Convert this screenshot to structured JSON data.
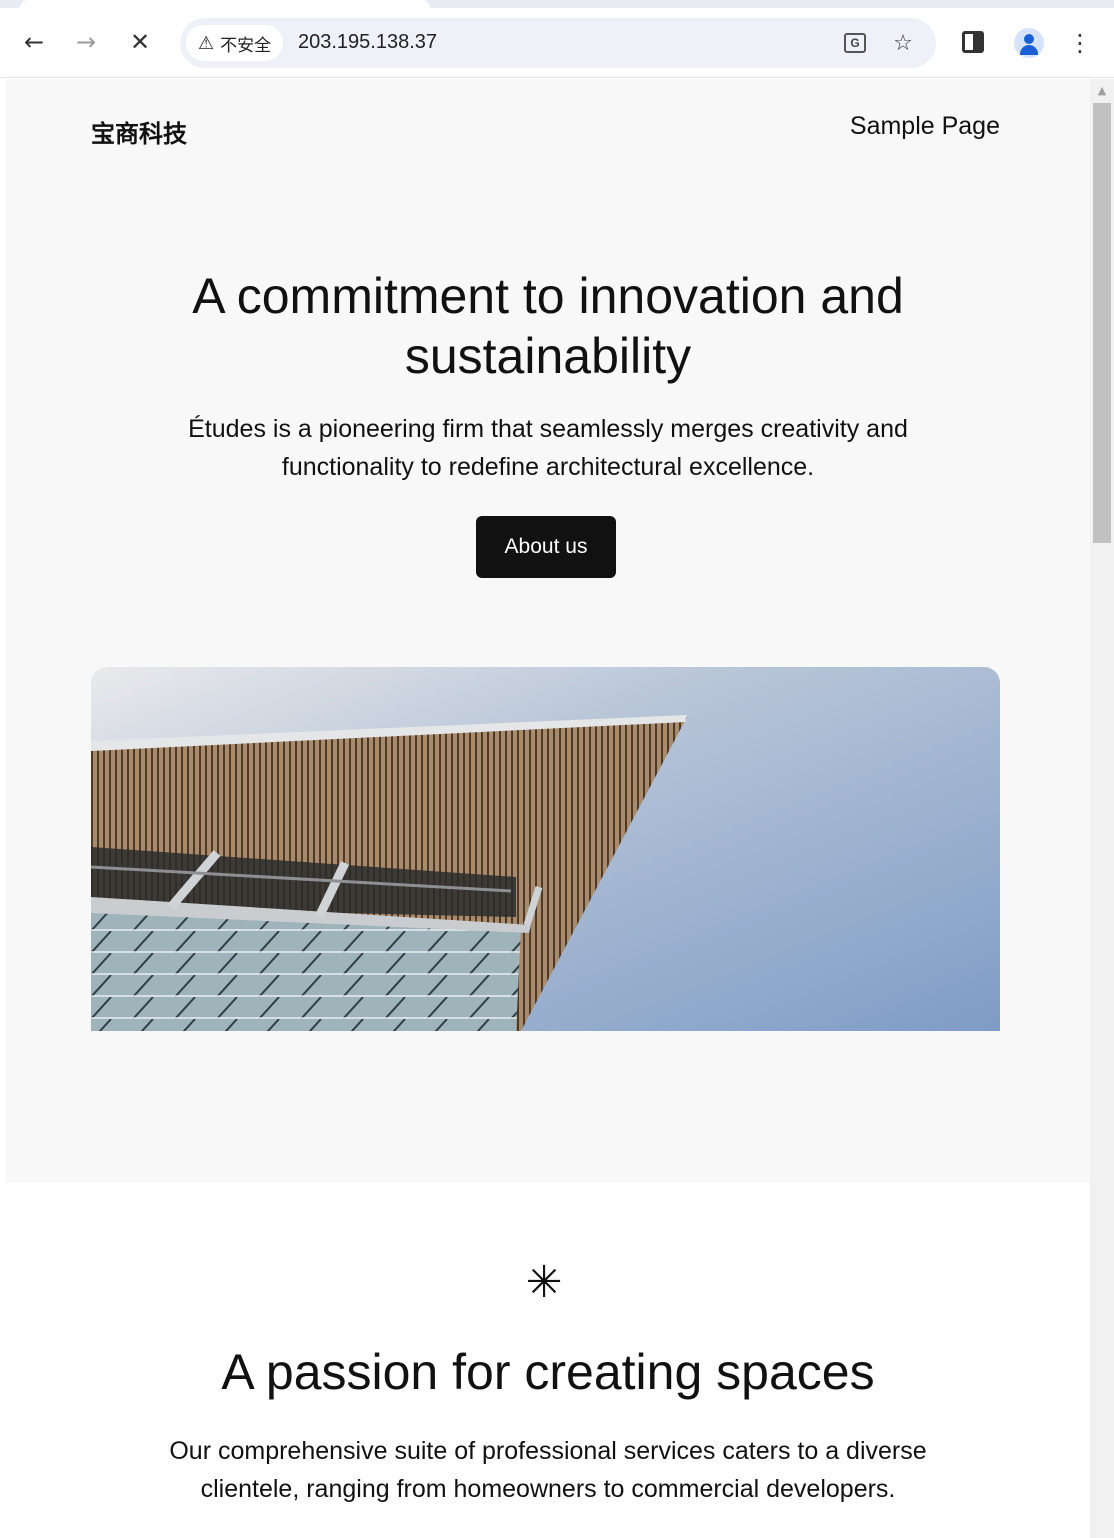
{
  "browser": {
    "security_label": "不安全",
    "url": "203.195.138.37",
    "nav_icons": [
      "back-arrow-icon",
      "forward-arrow-icon",
      "stop-loading-icon"
    ],
    "toolbar_icons": [
      "translate-icon",
      "bookmark-star-icon",
      "side-panel-icon",
      "profile-avatar-icon",
      "kebab-menu-icon"
    ]
  },
  "site": {
    "title": "宝商科技",
    "nav": [
      "Sample Page"
    ]
  },
  "hero": {
    "heading": "A commitment to innovation and sustainability",
    "text": "Études is a pioneering firm that seamlessly merges creativity and functionality to redefine architectural excellence.",
    "button_label": "About us",
    "image_alt": "building-facade-against-sky"
  },
  "section": {
    "icon": "asterisk-icon",
    "heading": "A passion for creating spaces",
    "text": "Our comprehensive suite of professional services caters to a diverse clientele, ranging from homeowners to commercial developers."
  },
  "colors": {
    "hero_background": "#f8f8f8",
    "button_background": "#111111",
    "button_text": "#ffffff",
    "omnibox_background": "#eef1f7",
    "avatar_accent": "#1a5fd6"
  }
}
